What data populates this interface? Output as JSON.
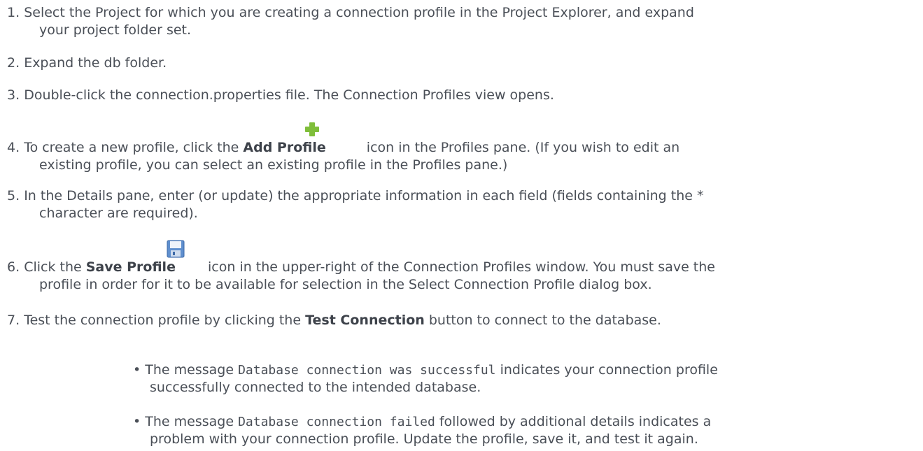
{
  "steps": [
    {
      "num": "1.",
      "lines": [
        "Select the Project for which you are creating a connection profile in the Project Explorer, and expand",
        "your project folder set."
      ]
    },
    {
      "num": "2.",
      "lines": [
        "Expand the db folder."
      ]
    },
    {
      "num": "3.",
      "lines": [
        "Double-click the connection.properties file. The Connection Profiles view opens."
      ]
    },
    {
      "num": "4.",
      "pre": "To create a new profile, click the ",
      "bold": "Add Profile",
      "post": " icon in the Profiles pane. (If you wish to edit an",
      "line2": "existing profile, you can select an existing profile in the Profiles pane.)"
    },
    {
      "num": "5.",
      "lines": [
        "In the Details pane, enter (or update) the appropriate information in each field (fields containing the *",
        "character are required)."
      ]
    },
    {
      "num": "6.",
      "pre": "Click the ",
      "bold": "Save Profile",
      "post": " icon in the upper-right of the Connection Profiles window.  You must save the",
      "line2": "profile in order for it to be available for selection in the Select Connection Profile dialog box."
    },
    {
      "num": "7.",
      "pre": "Test the connection profile by clicking the ",
      "bold": "Test Connection",
      "post": " button to connect to the database."
    }
  ],
  "bullets": [
    {
      "pre": "The message ",
      "code": "Database connection was successful",
      "post": " indicates your connection profile",
      "line2": "successfully connected to the intended database."
    },
    {
      "pre": "The message ",
      "code": "Database connection failed",
      "post": " followed by additional details indicates a",
      "line2": "problem with your connection profile. Update the profile, save it, and test it again."
    }
  ],
  "icons": {
    "add_profile": "add-profile-plus-icon",
    "save_profile": "save-profile-floppy-icon",
    "add_color": "#7fbe3a"
  }
}
